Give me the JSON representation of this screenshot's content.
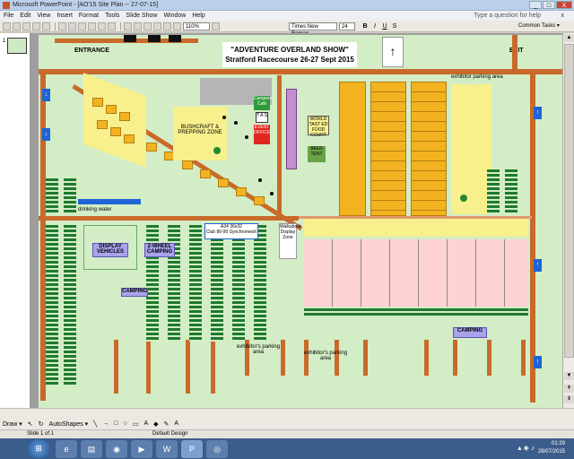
{
  "window": {
    "title": "Microsoft PowerPoint - [AO'15 Site Plan -- 27-07-15]",
    "minimize": "_",
    "maximize": "□",
    "close": "X"
  },
  "menu": {
    "items": [
      "File",
      "Edit",
      "View",
      "Insert",
      "Format",
      "Tools",
      "Slide Show",
      "Window",
      "Help"
    ],
    "help_text": "Type a question for help",
    "doc_close": "x"
  },
  "toolbar": {
    "zoom": "110%",
    "font": "Times New Roman",
    "size": "24",
    "bold": "B",
    "italic": "I",
    "underline": "U",
    "shadow": "S",
    "common_tasks": "Common Tasks ▾"
  },
  "slide_panel": {
    "thumb_number": "1"
  },
  "slide": {
    "banner_line1": "\"ADVENTURE OVERLAND SHOW\"",
    "banner_line2": "Stratford Racecourse 26-27 Sept 2015",
    "entrance": "ENTRANCE",
    "exit": "EXIT",
    "drinking_water": "drinking water",
    "display_vehicles": "DISPLAY VEHICLES",
    "two_wheel_camping": "2-WHEEL CAMPING",
    "camping_left": "CAMPING",
    "camping_right": "CAMPING",
    "a34_label": "A34 36x32",
    "club_label": "Club 80-90 Synchromesh",
    "world_tast": "WORLD TAST ED FOOD COURT",
    "campers_cafe": "Campers Café",
    "tas": "T A S",
    "event_office": "EVENT OFFICE",
    "beer_tent": "BEER TENT",
    "exhibitors_parking_1": "exhibitor's parking area",
    "exhibitors_parking_2": "exhibitor's parking area",
    "exhibitors_parking_top": "exhibitor parking area",
    "bushcraft": "BUSHCRAFT & PREPPING ZONE",
    "display_zone": "Walkabout Display Zone"
  },
  "drawbar": {
    "draw": "Draw ▾",
    "autoshapes": "AutoShapes ▾"
  },
  "statusbar": {
    "slide": "Slide 1 of 1",
    "design": "Default Design"
  },
  "taskbar": {
    "time": "01:29",
    "date": "28/07/2015"
  }
}
